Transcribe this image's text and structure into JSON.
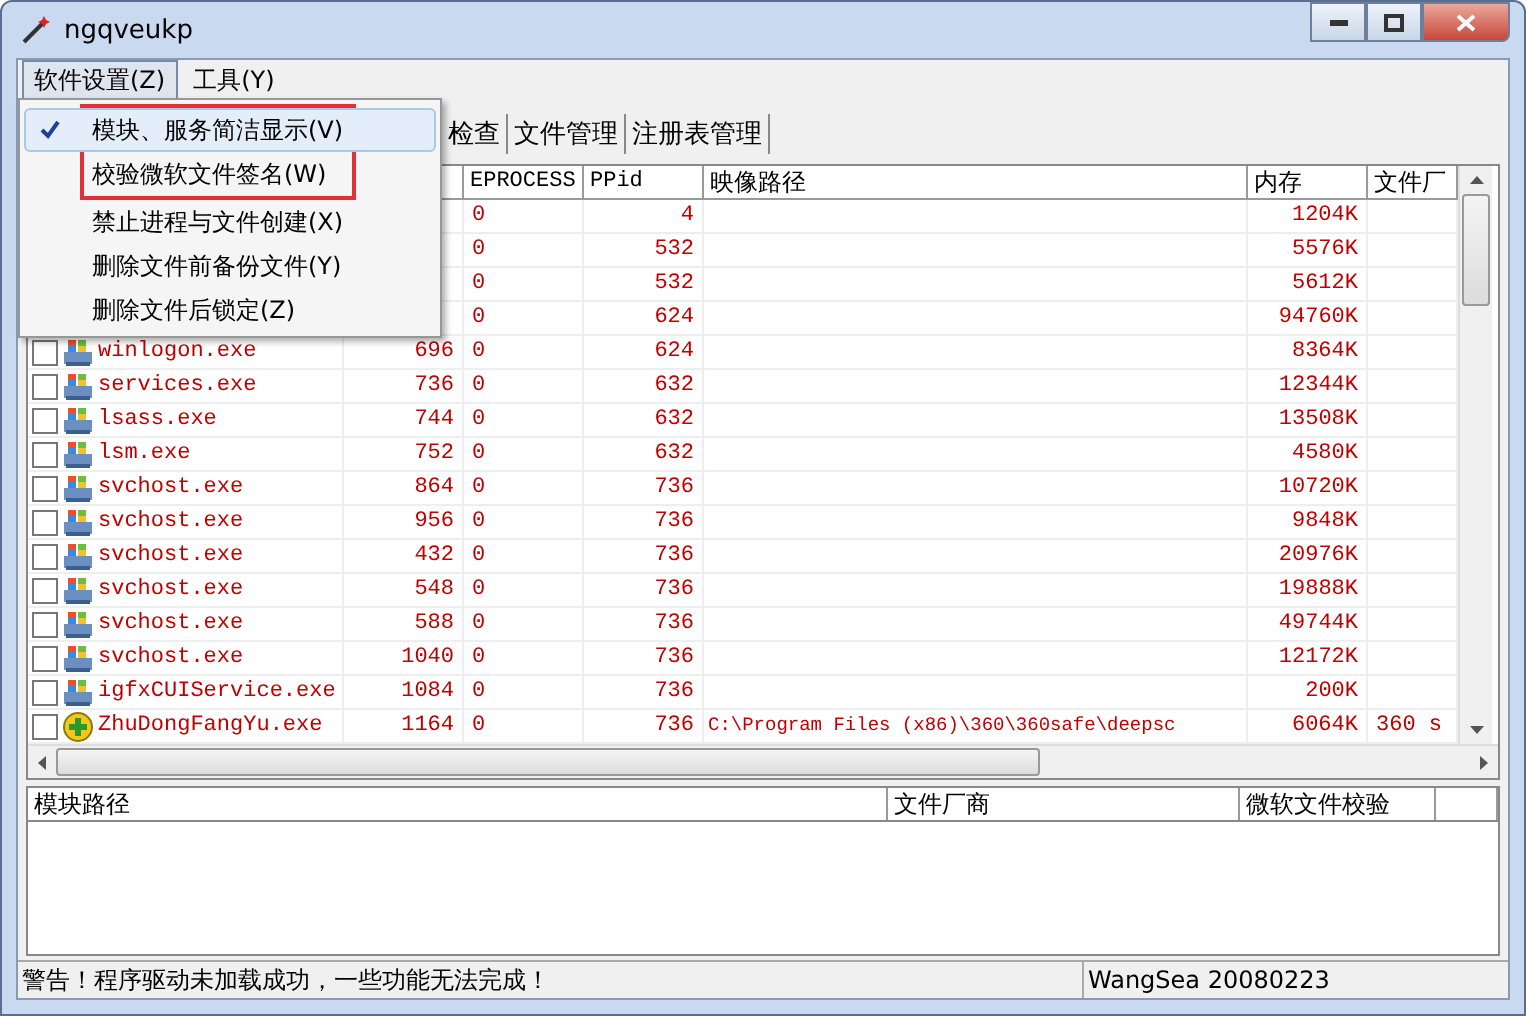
{
  "window": {
    "title": "ngqveukp"
  },
  "menubar": [
    {
      "label": "软件设置(Z)",
      "open": true
    },
    {
      "label": "工具(Y)",
      "open": false
    }
  ],
  "menu": [
    {
      "label": "模块、服务简洁显示(V)",
      "checked": true,
      "hovered": true,
      "marked": true
    },
    {
      "label": "校验微软文件签名(W)",
      "checked": false,
      "hovered": false,
      "marked": true
    },
    {
      "label": "禁止进程与文件创建(X)",
      "checked": false,
      "hovered": false,
      "marked": false
    },
    {
      "label": "删除文件前备份文件(Y)",
      "checked": false,
      "hovered": false,
      "marked": false
    },
    {
      "label": "删除文件后锁定(Z)",
      "checked": false,
      "hovered": false,
      "marked": false
    }
  ],
  "tabs": [
    {
      "label": "检查",
      "selected": false
    },
    {
      "label": "文件管理",
      "selected": false
    },
    {
      "label": "注册表管理",
      "selected": false
    }
  ],
  "process_table": {
    "columns": [
      "EPROCESS",
      "PPid",
      "映像路径",
      "内存",
      "文件厂"
    ],
    "rows": [
      {
        "eprocess": "0",
        "ppid": "4",
        "memory": "1204K"
      },
      {
        "eprocess": "0",
        "ppid": "532",
        "memory": "5576K"
      },
      {
        "eprocess": "0",
        "ppid": "532",
        "memory": "5612K"
      },
      {
        "eprocess": "0",
        "ppid": "624",
        "memory": "94760K"
      },
      {
        "name": "winlogon.exe",
        "pid": "696",
        "eprocess": "0",
        "ppid": "624",
        "memory": "8364K",
        "kind": "system",
        "checked": false
      },
      {
        "name": "services.exe",
        "pid": "736",
        "eprocess": "0",
        "ppid": "632",
        "memory": "12344K",
        "kind": "system",
        "checked": false
      },
      {
        "name": "lsass.exe",
        "pid": "744",
        "eprocess": "0",
        "ppid": "632",
        "memory": "13508K",
        "kind": "system",
        "checked": false
      },
      {
        "name": "lsm.exe",
        "pid": "752",
        "eprocess": "0",
        "ppid": "632",
        "memory": "4580K",
        "kind": "system",
        "checked": false
      },
      {
        "name": "svchost.exe",
        "pid": "864",
        "eprocess": "0",
        "ppid": "736",
        "memory": "10720K",
        "kind": "system",
        "checked": false
      },
      {
        "name": "svchost.exe",
        "pid": "956",
        "eprocess": "0",
        "ppid": "736",
        "memory": "9848K",
        "kind": "system",
        "checked": false
      },
      {
        "name": "svchost.exe",
        "pid": "432",
        "eprocess": "0",
        "ppid": "736",
        "memory": "20976K",
        "kind": "system",
        "checked": false
      },
      {
        "name": "svchost.exe",
        "pid": "548",
        "eprocess": "0",
        "ppid": "736",
        "memory": "19888K",
        "kind": "system",
        "checked": false
      },
      {
        "name": "svchost.exe",
        "pid": "588",
        "eprocess": "0",
        "ppid": "736",
        "memory": "49744K",
        "kind": "system",
        "checked": false
      },
      {
        "name": "svchost.exe",
        "pid": "1040",
        "eprocess": "0",
        "ppid": "736",
        "memory": "12172K",
        "kind": "system",
        "checked": false
      },
      {
        "name": "igfxCUIService.exe",
        "pid": "1084",
        "eprocess": "0",
        "ppid": "736",
        "memory": "200K",
        "kind": "system",
        "checked": false
      },
      {
        "name": "ZhuDongFangYu.exe",
        "pid": "1164",
        "eprocess": "0",
        "ppid": "736",
        "path": "C:\\Program Files (x86)\\360\\360safe\\deepsc",
        "memory": "6064K",
        "vendor": "360 s",
        "kind": "guard",
        "checked": false
      }
    ]
  },
  "module_table": {
    "columns": [
      "模块路径",
      "文件厂商",
      "微软文件校验"
    ]
  },
  "status_bar": [
    "警告！程序驱动未加载成功，一些功能无法完成！",
    "WangSea 20080223"
  ]
}
